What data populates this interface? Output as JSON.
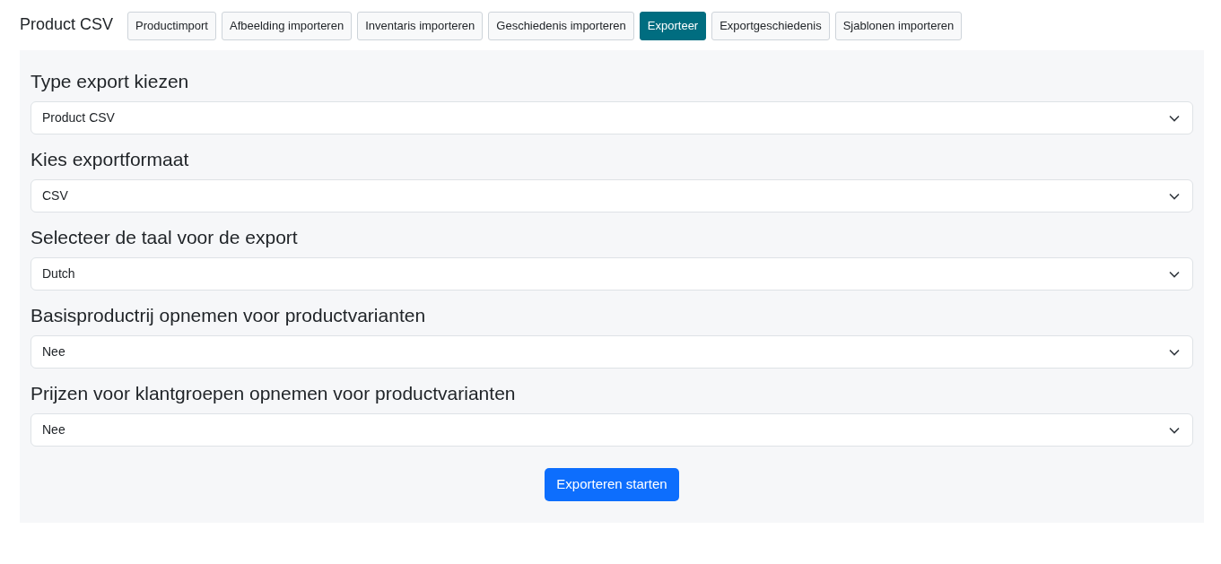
{
  "header": {
    "title": "Product CSV",
    "tabs": [
      {
        "label": "Productimport",
        "selected": false
      },
      {
        "label": "Afbeelding importeren",
        "selected": false
      },
      {
        "label": "Inventaris importeren",
        "selected": false
      },
      {
        "label": "Geschiedenis importeren",
        "selected": false
      },
      {
        "label": "Exporteer",
        "selected": true
      },
      {
        "label": "Exportgeschiedenis",
        "selected": false
      },
      {
        "label": "Sjablonen importeren",
        "selected": false
      }
    ]
  },
  "form": {
    "fields": [
      {
        "label": "Type export kiezen",
        "value": "Product CSV"
      },
      {
        "label": "Kies exportformaat",
        "value": "CSV"
      },
      {
        "label": "Selecteer de taal voor de export",
        "value": "Dutch"
      },
      {
        "label": "Basisproductrij opnemen voor productvarianten",
        "value": "Nee"
      },
      {
        "label": "Prijzen voor klantgroepen opnemen voor productvarianten",
        "value": "Nee"
      }
    ],
    "submit": "Exporteren starten"
  }
}
